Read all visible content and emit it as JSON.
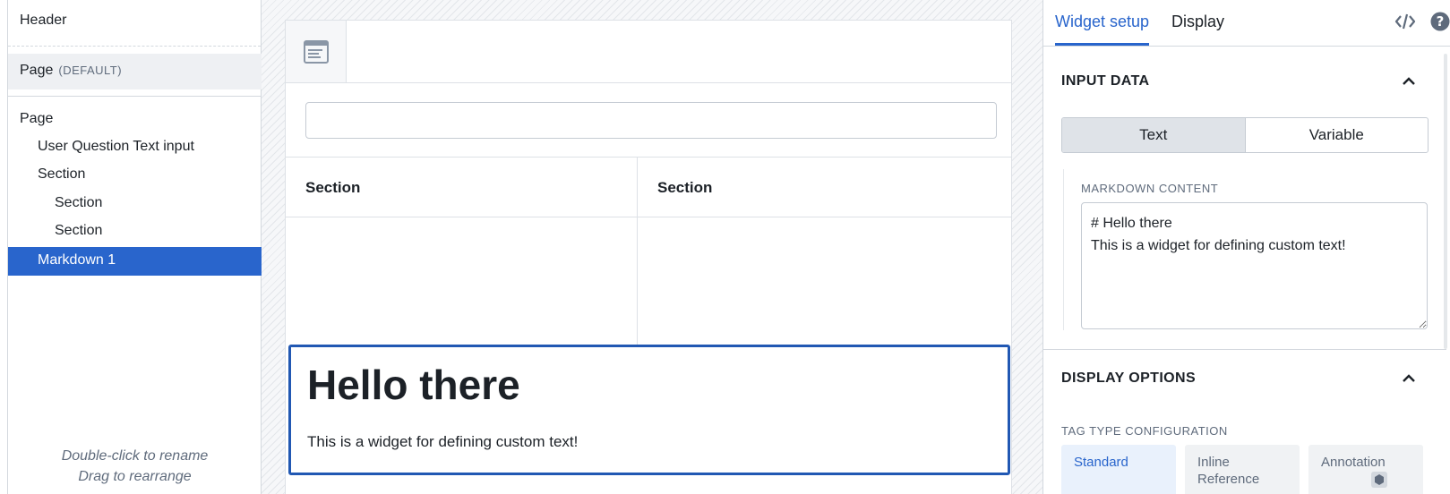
{
  "outline": {
    "header": "Header",
    "page_default": {
      "label": "Page",
      "tag": "(DEFAULT)"
    },
    "tree": [
      {
        "label": "Page",
        "depth": 0,
        "selected": false
      },
      {
        "label": "User Question Text input",
        "depth": 1,
        "selected": false
      },
      {
        "label": "Section",
        "depth": 1,
        "selected": false
      },
      {
        "label": "Section",
        "depth": 2,
        "selected": false
      },
      {
        "label": "Section",
        "depth": 2,
        "selected": false
      },
      {
        "label": "Markdown 1",
        "depth": 1,
        "selected": true
      }
    ],
    "hint_rename": "Double-click to rename",
    "hint_drag": "Drag to rearrange"
  },
  "canvas": {
    "text_input": {
      "value": "",
      "placeholder": ""
    },
    "sections": [
      "Section",
      "Section"
    ],
    "markdown": {
      "heading": "Hello there",
      "body": "This is a widget for defining custom text!"
    }
  },
  "config": {
    "tabs": [
      "Widget setup",
      "Display"
    ],
    "active_tab": "Widget setup",
    "input_data": {
      "title": "INPUT DATA",
      "mode_options": [
        "Text",
        "Variable"
      ],
      "selected_mode": "Text",
      "markdown_label": "MARKDOWN CONTENT",
      "markdown_value": "# Hello there\nThis is a widget for defining custom text!"
    },
    "display_options": {
      "title": "DISPLAY OPTIONS",
      "tag_type_label": "TAG TYPE CONFIGURATION",
      "tag_types": [
        "Standard",
        "Inline Reference",
        "Annotation"
      ],
      "selected_tag_type": "Standard"
    }
  },
  "icons": {
    "widget": "widget-card-icon",
    "code": "code-icon",
    "help": "help-icon",
    "collapse": "chevron-up-icon",
    "annotation_badge": "cube-icon"
  },
  "colors": {
    "accent": "#2965cc",
    "selected_border": "#2158b3",
    "muted_text": "#5f6b7c",
    "selected_bg": "#dfe3e8"
  }
}
